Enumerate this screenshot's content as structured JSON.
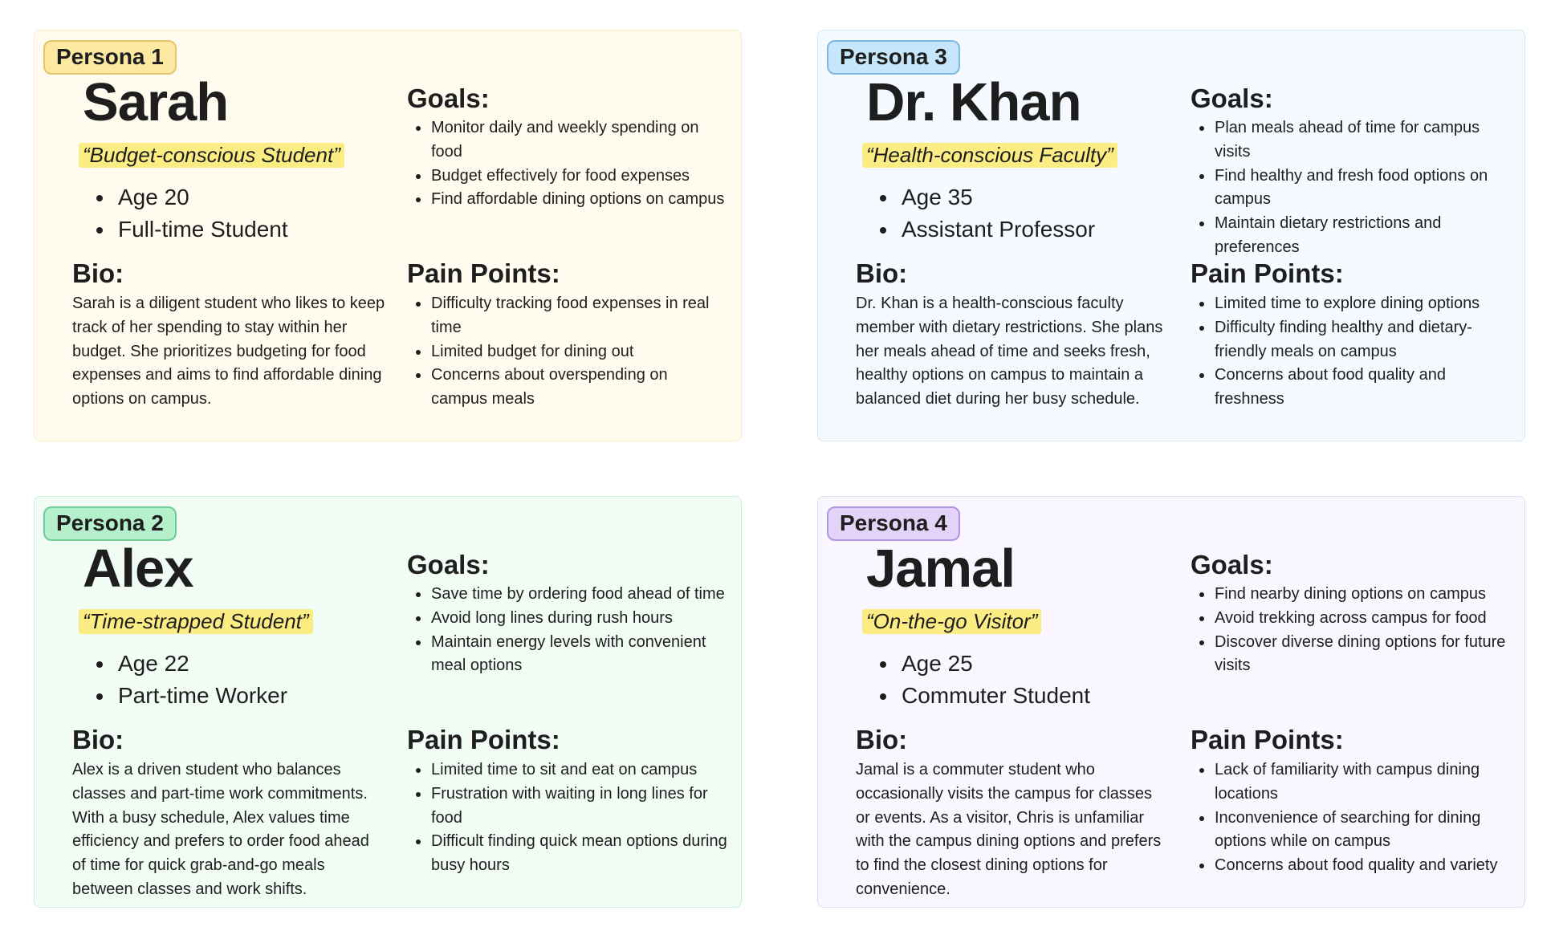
{
  "personas": [
    {
      "tag": "Persona 1",
      "name": "Sarah",
      "quote": "“Budget-conscious Student”",
      "facts": [
        "Age 20",
        "Full-time Student"
      ],
      "bio_heading": "Bio:",
      "bio": "Sarah is a diligent student who likes to keep track of her spending to stay within her budget. She prioritizes budgeting for food expenses and aims to find affordable dining options on campus.",
      "goals_heading": "Goals:",
      "goals": [
        "Monitor daily and weekly spending on food",
        "Budget effectively for food expenses",
        "Find affordable dining options on campus"
      ],
      "pain_heading": "Pain Points:",
      "pain_points": [
        "Difficulty tracking food expenses in real time",
        "Limited budget for dining out",
        "Concerns about overspending on campus meals"
      ],
      "colors": {
        "card_bg": "#fffcef",
        "card_border": "#f7ecc5",
        "tag_bg": "#fde8a2",
        "tag_border": "#e5c46b"
      }
    },
    {
      "tag": "Persona 3",
      "name": "Dr. Khan",
      "quote": "“Health-conscious Faculty”",
      "facts": [
        "Age 35",
        "Assistant Professor"
      ],
      "bio_heading": "Bio:",
      "bio": "Dr. Khan is a health-conscious faculty member with dietary restrictions. She plans her meals ahead of time and seeks fresh, healthy options on campus to maintain a balanced diet during her busy schedule.",
      "goals_heading": "Goals:",
      "goals": [
        "Plan meals ahead of time for campus visits",
        "Find healthy and fresh food options on campus",
        "Maintain dietary restrictions and preferences"
      ],
      "pain_heading": "Pain Points:",
      "pain_points": [
        "Limited time to explore dining options",
        "Difficulty finding healthy and dietary-friendly meals on campus",
        "Concerns about food quality and freshness"
      ],
      "colors": {
        "card_bg": "#f4faff",
        "card_border": "#cfe6f3",
        "tag_bg": "#c5e6fb",
        "tag_border": "#7fb8de"
      }
    },
    {
      "tag": "Persona 2",
      "name": "Alex",
      "quote": "“Time-strapped Student”",
      "facts": [
        "Age 22",
        "Part-time Worker"
      ],
      "bio_heading": "Bio:",
      "bio": "Alex is a driven student who balances classes and part-time work commitments. With a busy schedule, Alex values time efficiency and prefers to order food ahead of time for quick grab-and-go meals between classes and work shifts.",
      "goals_heading": "Goals:",
      "goals": [
        "Save time by ordering food ahead of time",
        "Avoid long lines during rush hours",
        "Maintain energy levels with convenient meal options"
      ],
      "pain_heading": "Pain Points:",
      "pain_points": [
        "Limited time to sit and eat on campus",
        "Frustration with waiting in long lines for food",
        "Difficult finding quick mean options during busy hours"
      ],
      "colors": {
        "card_bg": "#f1fcf5",
        "card_border": "#c8eed6",
        "tag_bg": "#b6efcc",
        "tag_border": "#6ccf95"
      }
    },
    {
      "tag": "Persona 4",
      "name": "Jamal",
      "quote": "“On-the-go Visitor”",
      "facts": [
        "Age 25",
        "Commuter Student"
      ],
      "bio_heading": "Bio:",
      "bio": "Jamal is a commuter student who occasionally visits the campus for classes or events. As a visitor, Chris is unfamiliar with the campus dining options and prefers to find the closest dining options for convenience.",
      "goals_heading": "Goals:",
      "goals": [
        "Find nearby dining options on campus",
        "Avoid trekking across campus for food",
        "Discover diverse dining options for future visits"
      ],
      "pain_heading": "Pain Points:",
      "pain_points": [
        "Lack of familiarity with campus dining locations",
        "Inconvenience of searching for dining options while on campus",
        "Concerns about food quality and variety"
      ],
      "colors": {
        "card_bg": "#f9f6ff",
        "card_border": "#e2daf3",
        "tag_bg": "#e3d3f9",
        "tag_border": "#b195dd"
      }
    }
  ]
}
